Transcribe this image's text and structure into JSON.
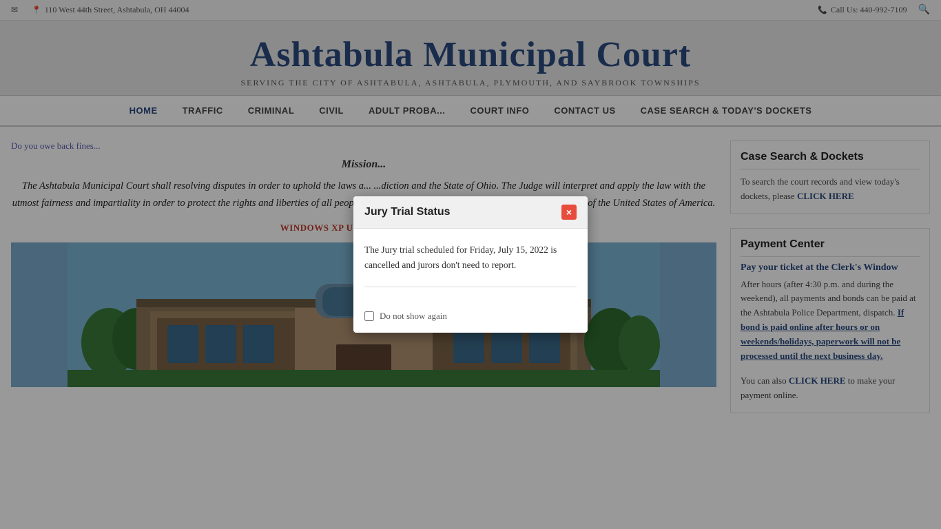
{
  "topbar": {
    "address": "110 West 44th Street, Ashtabula, OH 44004",
    "phone_label": "Call Us: 440-992-7109"
  },
  "header": {
    "title": "Ashtabula Municipal Court",
    "subtitle": "SERVING THE CITY OF ASHTABULA, ASHTABULA, PLYMOUTH, AND SAYBROOK TOWNSHIPS"
  },
  "nav": {
    "items": [
      {
        "label": "HOME",
        "active": true
      },
      {
        "label": "TRAFFIC"
      },
      {
        "label": "CRIMINAL"
      },
      {
        "label": "CIVIL"
      },
      {
        "label": "ADULT PROBA..."
      },
      {
        "label": "COURT INFO"
      },
      {
        "label": "CONTACT US"
      },
      {
        "label": "CASE SEARCH & TODAY'S DOCKETS"
      }
    ]
  },
  "main": {
    "back_fines_text": "Do you owe back fines...",
    "mission_title": "Mission...",
    "mission_text": "The Ashtabula Municipal Court shall resolving disputes in order to uphold the laws a... ...diction and the State of Ohio. The Judge will interpret and apply the law with the utmost fairness and impartiality in order to protect the rights and liberties of all people guaranteed by the Constitution of the State of Ohio and of the United States of America.",
    "windows_link": "WINDOWS XP USERS – CLICK HERE"
  },
  "sidebar": {
    "case_search": {
      "title": "Case Search & Dockets",
      "text": "To search the court records and view today's dockets, please",
      "link_text": "CLICK HERE"
    },
    "payment": {
      "title": "Payment Center",
      "payment_title": "Pay your ticket at the Clerk's Window",
      "text1": "After hours (after 4:30 p.m. and during the weekend), all payments and bonds can be paid at the Ashtabula Police Department, dispatch.",
      "link_text": "If bond is paid online after hours or on weekends/holidays, paperwork will not be processed until the next business day.",
      "text2": "You can also",
      "link2_text": "CLICK HERE",
      "text3": "to make your payment online."
    }
  },
  "modal": {
    "title": "Jury Trial Status",
    "body": "The Jury trial scheduled for Friday, July 15, 2022 is cancelled and jurors don't need to report.",
    "checkbox_label": "Do not show again",
    "close_icon": "×"
  }
}
